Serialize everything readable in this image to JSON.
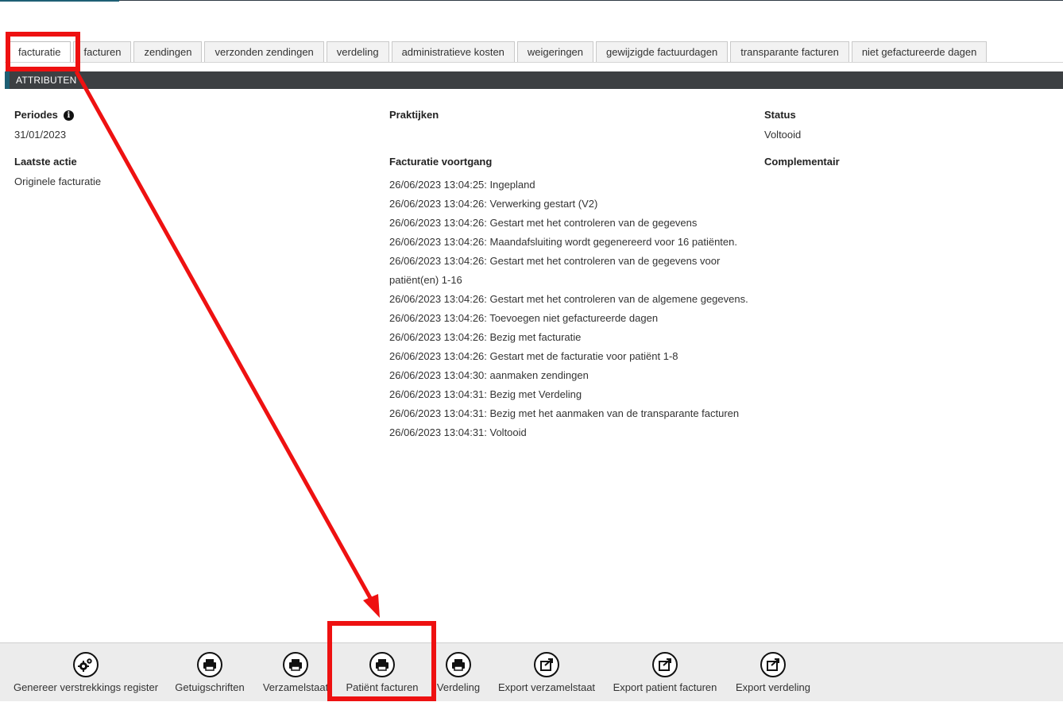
{
  "tabs": [
    {
      "label": "facturatie",
      "active": true
    },
    {
      "label": "facturen"
    },
    {
      "label": "zendingen"
    },
    {
      "label": "verzonden zendingen"
    },
    {
      "label": "verdeling"
    },
    {
      "label": "administratieve kosten"
    },
    {
      "label": "weigeringen"
    },
    {
      "label": "gewijzigde factuurdagen"
    },
    {
      "label": "transparante facturen"
    },
    {
      "label": "niet gefactureerde dagen"
    }
  ],
  "section": {
    "title": "ATTRIBUTEN"
  },
  "attributes": {
    "periods_label": "Periodes",
    "periods_value": "31/01/2023",
    "last_action_label": "Laatste actie",
    "last_action_value": "Originele facturatie",
    "practices_label": "Praktijken",
    "progress_label": "Facturatie voortgang",
    "progress": [
      "26/06/2023 13:04:25: Ingepland",
      "26/06/2023 13:04:26: Verwerking gestart (V2)",
      "26/06/2023 13:04:26: Gestart met het controleren van de gegevens",
      "26/06/2023 13:04:26: Maandafsluiting wordt gegenereerd voor 16 patiënten.",
      "26/06/2023 13:04:26: Gestart met het controleren van de gegevens voor",
      "patiënt(en) 1-16",
      "26/06/2023 13:04:26: Gestart met het controleren van de algemene gegevens.",
      "26/06/2023 13:04:26: Toevoegen niet gefactureerde dagen",
      "26/06/2023 13:04:26: Bezig met facturatie",
      "26/06/2023 13:04:26: Gestart met de facturatie voor patiënt 1-8",
      "26/06/2023 13:04:30: aanmaken zendingen",
      "26/06/2023 13:04:31: Bezig met Verdeling",
      "26/06/2023 13:04:31: Bezig met het aanmaken van de transparante facturen",
      "26/06/2023 13:04:31: Voltooid"
    ],
    "status_label": "Status",
    "status_value": "Voltooid",
    "complementary_label": "Complementair"
  },
  "toolbar": [
    {
      "label": "Genereer verstrekkings register",
      "icon": "gears-icon"
    },
    {
      "label": "Getuigschriften",
      "icon": "print-icon"
    },
    {
      "label": "Verzamelstaat",
      "icon": "print-icon"
    },
    {
      "label": "Patiënt facturen",
      "icon": "print-icon"
    },
    {
      "label": "Verdeling",
      "icon": "print-icon"
    },
    {
      "label": "Export verzamelstaat",
      "icon": "export-icon"
    },
    {
      "label": "Export patient facturen",
      "icon": "export-icon"
    },
    {
      "label": "Export verdeling",
      "icon": "export-icon"
    }
  ],
  "colors": {
    "accent": "#1e5f74",
    "header_bg": "#3c3f42",
    "annotation": "#ee1111"
  }
}
